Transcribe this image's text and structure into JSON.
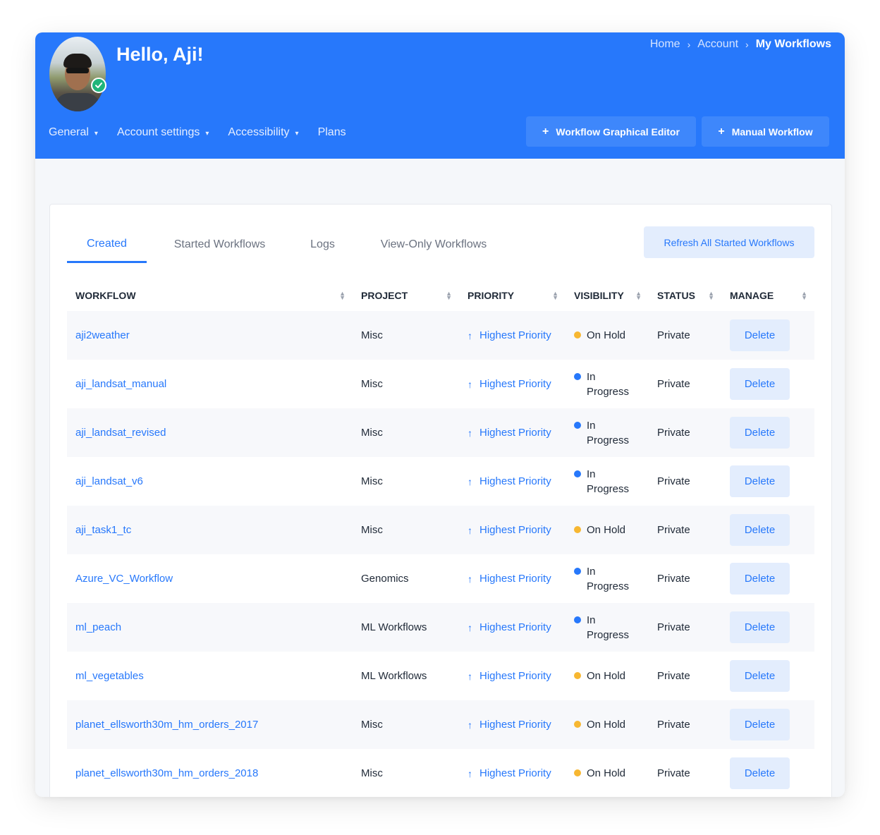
{
  "header": {
    "greeting": "Hello, Aji!",
    "breadcrumb": [
      "Home",
      "Account",
      "My Workflows"
    ],
    "nav": [
      {
        "label": "General",
        "dropdown": true
      },
      {
        "label": "Account settings",
        "dropdown": true
      },
      {
        "label": "Accessibility",
        "dropdown": true
      },
      {
        "label": "Plans",
        "dropdown": false
      }
    ],
    "buttons": {
      "graphical_editor": "Workflow Graphical Editor",
      "manual_workflow": "Manual Workflow"
    }
  },
  "tabs": [
    "Created",
    "Started Workflows",
    "Logs",
    "View-Only Workflows"
  ],
  "active_tab": "Created",
  "refresh_label": "Refresh All Started Workflows",
  "table": {
    "columns": [
      "WORKFLOW",
      "PROJECT",
      "PRIORITY",
      "VISIBILITY",
      "STATUS",
      "MANAGE"
    ],
    "rows": [
      {
        "workflow": "aji2weather",
        "project": "Misc",
        "priority": "Highest Priority",
        "visibility": "On Hold",
        "status": "Private",
        "action": "Delete"
      },
      {
        "workflow": "aji_landsat_manual",
        "project": "Misc",
        "priority": "Highest Priority",
        "visibility": "In Progress",
        "status": "Private",
        "action": "Delete"
      },
      {
        "workflow": "aji_landsat_revised",
        "project": "Misc",
        "priority": "Highest Priority",
        "visibility": "In Progress",
        "status": "Private",
        "action": "Delete"
      },
      {
        "workflow": "aji_landsat_v6",
        "project": "Misc",
        "priority": "Highest Priority",
        "visibility": "In Progress",
        "status": "Private",
        "action": "Delete"
      },
      {
        "workflow": "aji_task1_tc",
        "project": "Misc",
        "priority": "Highest Priority",
        "visibility": "On Hold",
        "status": "Private",
        "action": "Delete"
      },
      {
        "workflow": "Azure_VC_Workflow",
        "project": "Genomics",
        "priority": "Highest Priority",
        "visibility": "In Progress",
        "status": "Private",
        "action": "Delete"
      },
      {
        "workflow": "ml_peach",
        "project": "ML Workflows",
        "priority": "Highest Priority",
        "visibility": "In Progress",
        "status": "Private",
        "action": "Delete"
      },
      {
        "workflow": "ml_vegetables",
        "project": "ML Workflows",
        "priority": "Highest Priority",
        "visibility": "On Hold",
        "status": "Private",
        "action": "Delete"
      },
      {
        "workflow": "planet_ellsworth30m_hm_orders_2017",
        "project": "Misc",
        "priority": "Highest Priority",
        "visibility": "On Hold",
        "status": "Private",
        "action": "Delete"
      },
      {
        "workflow": "planet_ellsworth30m_hm_orders_2018",
        "project": "Misc",
        "priority": "Highest Priority",
        "visibility": "On Hold",
        "status": "Private",
        "action": "Delete"
      }
    ]
  },
  "colors": {
    "accent": "#2778fb",
    "on_hold": "#f7b731",
    "in_progress": "#2778fb",
    "verified": "#1fb57a"
  },
  "icons": [
    "chevron-down-icon",
    "plus-icon",
    "sort-icon",
    "arrow-up-icon",
    "check-icon",
    "status-dot-icon"
  ]
}
